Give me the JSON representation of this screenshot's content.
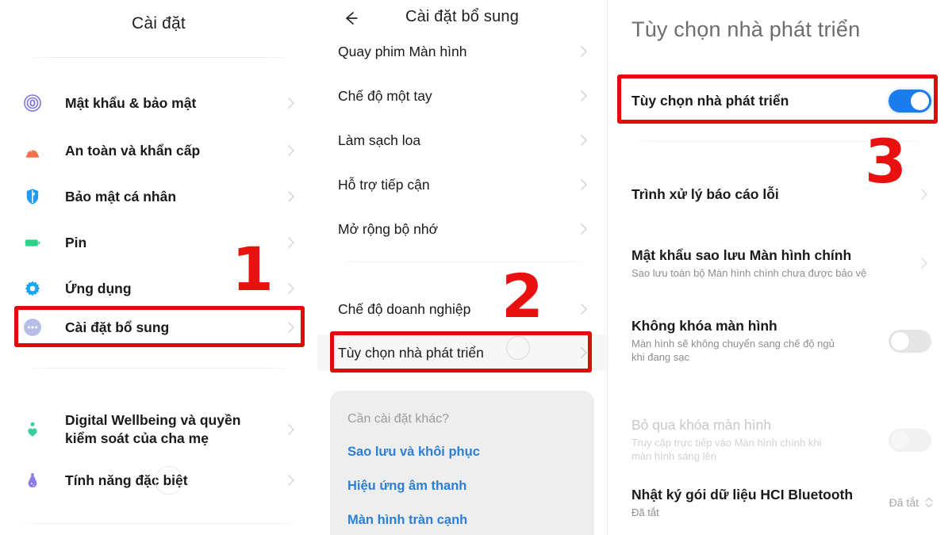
{
  "panel1": {
    "header": {
      "title": "Cài đặt"
    },
    "items": [
      {
        "label": "Mật khẩu & bảo mật",
        "icon": "fingerprint-icon",
        "color": "#7b77d8"
      },
      {
        "label": "An toàn và khẩn cấp",
        "icon": "emergency-siren-icon",
        "color": "#f4714f"
      },
      {
        "label": "Bảo mật cá nhân",
        "icon": "privacy-shield-icon",
        "color": "#1e9cf0"
      },
      {
        "label": "Pin",
        "icon": "battery-icon",
        "color": "#2ed18b"
      },
      {
        "label": "Ứng dụng",
        "icon": "gear-icon",
        "color": "#1ba7f0"
      },
      {
        "label": "Cài đặt bổ sung",
        "icon": "more-dots-icon",
        "color": "#aeb6e8"
      }
    ],
    "items_group2": [
      {
        "label": "Digital Wellbeing và quyền\nkiểm soát của cha mẹ",
        "icon": "wellbeing-heart-icon",
        "color": "#36cf9a"
      },
      {
        "label": "Tính năng đặc biệt",
        "icon": "special-features-flask-icon",
        "color": "#8a7ce8"
      }
    ]
  },
  "panel2": {
    "header": {
      "title": "Cài đặt bổ sung",
      "back": "back-arrow"
    },
    "items": [
      {
        "label": "Quay phim Màn hình"
      },
      {
        "label": "Chế độ một tay"
      },
      {
        "label": "Làm sạch loa"
      },
      {
        "label": "Hỗ trợ tiếp cận"
      },
      {
        "label": "Mở rộng bộ nhớ"
      }
    ],
    "items_group2": [
      {
        "label": "Chế độ doanh nghiệp"
      },
      {
        "label": "Tùy chọn nhà phát triển"
      }
    ],
    "suggestions": {
      "title": "Cần cài đặt khác?",
      "links": [
        "Sao lưu và khôi phục",
        "Hiệu ứng âm thanh",
        "Màn hình tràn cạnh"
      ]
    }
  },
  "panel3": {
    "header": {
      "title": "Tùy chọn nhà phát triển"
    },
    "master_toggle": {
      "label": "Tùy chọn nhà phát triển",
      "state": "on"
    },
    "items": [
      {
        "label": "Trình xử lý báo cáo lỗi",
        "sub": "",
        "control": "chevron",
        "dim": false
      },
      {
        "label": "Mật khẩu sao lưu Màn hình chính",
        "sub": "Sao lưu toàn bộ Màn hình chính chưa được bảo vệ",
        "control": "chevron",
        "dim": false
      },
      {
        "label": "Không khóa màn hình",
        "sub": "Màn hình sẽ không chuyển sang chế độ ngủ\nkhi đang sạc",
        "control": "toggle-off",
        "dim": false
      },
      {
        "label": "Bỏ qua khóa màn hình",
        "sub": "Truy cập trực tiếp vào Màn hình chính khi\nmàn hình sáng lên",
        "control": "toggle-off-faded",
        "dim": true
      },
      {
        "label": "Nhật ký gói dữ liệu HCI Bluetooth",
        "sub": "Đã tắt",
        "control": "stepper",
        "value": "Đã tắt",
        "dim": false
      }
    ]
  },
  "annotations": {
    "step1": "1",
    "step2": "2",
    "step3": "3",
    "highlight_color": "#e20a0a"
  }
}
